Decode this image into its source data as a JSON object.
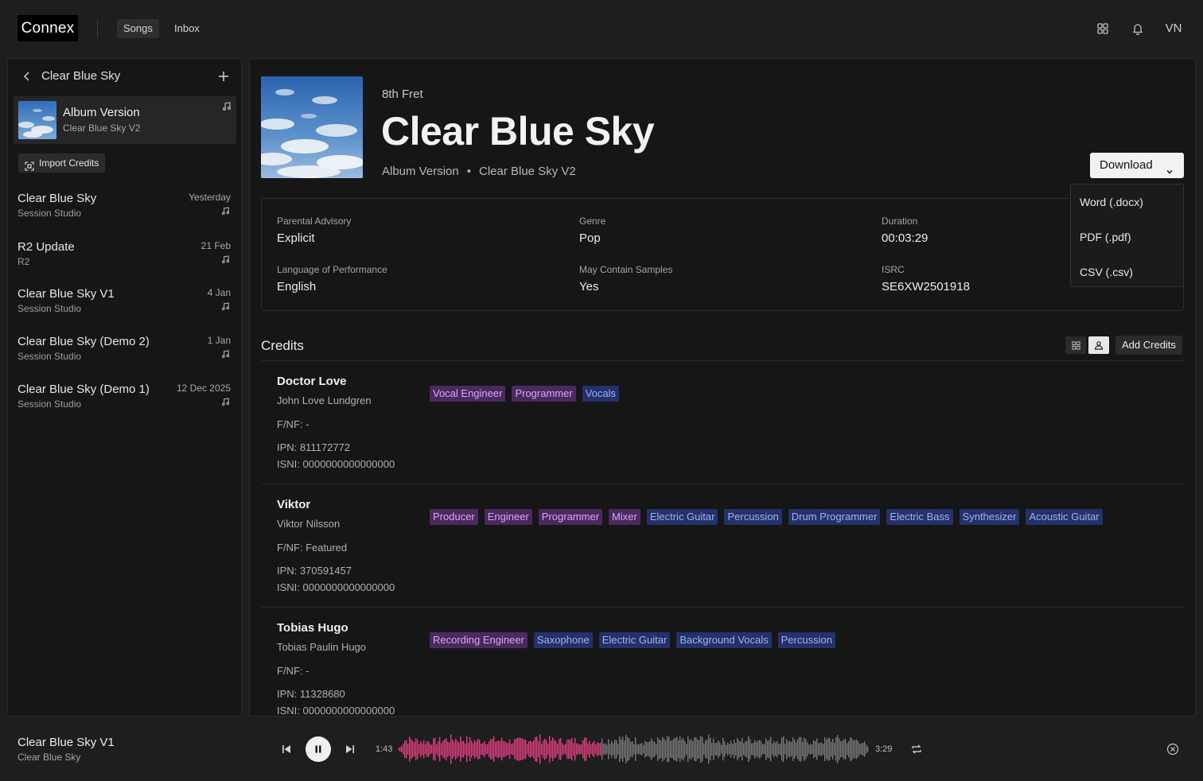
{
  "app": {
    "logo": "Connex",
    "nav": [
      {
        "label": "Songs",
        "active": true
      },
      {
        "label": "Inbox",
        "active": false
      }
    ],
    "user_initials": "VN",
    "icons": [
      "apps-grid-icon",
      "bell-icon"
    ]
  },
  "sidebar": {
    "title": "Clear Blue Sky",
    "current": {
      "title": "Album Version",
      "subtitle": "Clear Blue Sky V2"
    },
    "import_label": "Import Credits",
    "versions": [
      {
        "title": "Clear Blue Sky",
        "subtitle": "Session Studio",
        "date": "Yesterday"
      },
      {
        "title": "R2 Update",
        "subtitle": "R2",
        "date": "21 Feb"
      },
      {
        "title": "Clear Blue Sky V1",
        "subtitle": "Session Studio",
        "date": "4 Jan"
      },
      {
        "title": "Clear Blue Sky (Demo 2)",
        "subtitle": "Session Studio",
        "date": "1 Jan"
      },
      {
        "title": "Clear Blue Sky (Demo 1)",
        "subtitle": "Session Studio",
        "date": "12 Dec 2025"
      }
    ]
  },
  "song": {
    "artist": "8th Fret",
    "title": "Clear Blue Sky",
    "version": "Album Version",
    "separator": "•",
    "version_name": "Clear Blue Sky V2",
    "download_label": "Download",
    "download_options": [
      "Word (.docx)",
      "PDF (.pdf)",
      "CSV (.csv)"
    ],
    "meta": {
      "parental_advisory": {
        "label": "Parental Advisory",
        "value": "Explicit"
      },
      "genre": {
        "label": "Genre",
        "value": "Pop"
      },
      "duration": {
        "label": "Duration",
        "value": "00:03:29"
      },
      "language": {
        "label": "Language of Performance",
        "value": "English"
      },
      "samples": {
        "label": "May Contain Samples",
        "value": "Yes"
      },
      "isrc": {
        "label": "ISRC",
        "value": "SE6XW2501918"
      }
    }
  },
  "credits": {
    "heading": "Credits",
    "add_label": "Add Credits",
    "people": [
      {
        "name": "Doctor Love",
        "legal": "John Love  Lundgren",
        "fnf": "F/NF: -",
        "ipn": "IPN:  811172772",
        "isni": "ISNI: 0000000000000000",
        "roles": [
          {
            "label": "Vocal Engineer",
            "kind": "p"
          },
          {
            "label": "Programmer",
            "kind": "p"
          },
          {
            "label": "Vocals",
            "kind": "b"
          }
        ]
      },
      {
        "name": "Viktor",
        "legal": "Viktor  Nilsson",
        "fnf": "F/NF: Featured",
        "ipn": "IPN:  370591457",
        "isni": "ISNI: 0000000000000000",
        "roles": [
          {
            "label": "Producer",
            "kind": "p"
          },
          {
            "label": "Engineer",
            "kind": "p"
          },
          {
            "label": "Programmer",
            "kind": "p"
          },
          {
            "label": "Mixer",
            "kind": "p"
          },
          {
            "label": "Electric Guitar",
            "kind": "b"
          },
          {
            "label": "Percussion",
            "kind": "b"
          },
          {
            "label": "Drum Programmer",
            "kind": "b"
          },
          {
            "label": "Electric Bass",
            "kind": "b"
          },
          {
            "label": "Synthesizer",
            "kind": "b"
          },
          {
            "label": "Acoustic Guitar",
            "kind": "b"
          }
        ]
      },
      {
        "name": "Tobias Hugo",
        "legal": "Tobias  Paulin  Hugo",
        "fnf": "F/NF: -",
        "ipn": "IPN:  11328680",
        "isni": "ISNI: 0000000000000000",
        "roles": [
          {
            "label": "Recording Engineer",
            "kind": "p"
          },
          {
            "label": "Saxophone",
            "kind": "b"
          },
          {
            "label": "Electric Guitar",
            "kind": "b"
          },
          {
            "label": "Background Vocals",
            "kind": "b"
          },
          {
            "label": "Percussion",
            "kind": "b"
          }
        ]
      }
    ]
  },
  "player": {
    "title": "Clear Blue Sky V1",
    "subtitle": "Clear Blue Sky",
    "elapsed": "1:43",
    "total": "3:29",
    "progress": 0.43,
    "played_color": "#e0407f",
    "unplayed_color": "#7a7a7a"
  },
  "colors": {
    "role_purple_bg": "#4a2a5e",
    "role_blue_bg": "#24316a"
  }
}
